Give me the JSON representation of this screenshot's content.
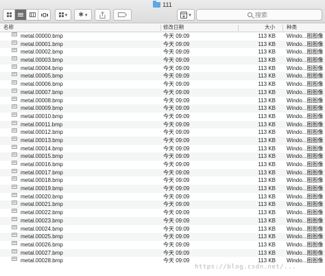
{
  "window": {
    "title": "111"
  },
  "toolbar": {
    "search_placeholder": "搜索"
  },
  "columns": {
    "name": "名称",
    "date": "修改日期",
    "size": "大小",
    "kind": "种类"
  },
  "files": [
    {
      "name": "metal.00000.bmp",
      "date": "今天 09:09",
      "size": "113 KB",
      "kind": "Windo...图图像"
    },
    {
      "name": "metal.00001.bmp",
      "date": "今天 09:09",
      "size": "113 KB",
      "kind": "Windo...图图像"
    },
    {
      "name": "metal.00002.bmp",
      "date": "今天 09:09",
      "size": "113 KB",
      "kind": "Windo...图图像"
    },
    {
      "name": "metal.00003.bmp",
      "date": "今天 09:09",
      "size": "113 KB",
      "kind": "Windo...图图像"
    },
    {
      "name": "metal.00004.bmp",
      "date": "今天 09:09",
      "size": "113 KB",
      "kind": "Windo...图图像"
    },
    {
      "name": "metal.00005.bmp",
      "date": "今天 09:09",
      "size": "113 KB",
      "kind": "Windo...图图像"
    },
    {
      "name": "metal.00006.bmp",
      "date": "今天 09:09",
      "size": "113 KB",
      "kind": "Windo...图图像"
    },
    {
      "name": "metal.00007.bmp",
      "date": "今天 09:09",
      "size": "113 KB",
      "kind": "Windo...图图像"
    },
    {
      "name": "metal.00008.bmp",
      "date": "今天 09:09",
      "size": "113 KB",
      "kind": "Windo...图图像"
    },
    {
      "name": "metal.00009.bmp",
      "date": "今天 09:09",
      "size": "113 KB",
      "kind": "Windo...图图像"
    },
    {
      "name": "metal.00010.bmp",
      "date": "今天 09:09",
      "size": "113 KB",
      "kind": "Windo...图图像"
    },
    {
      "name": "metal.00011.bmp",
      "date": "今天 09:09",
      "size": "113 KB",
      "kind": "Windo...图图像"
    },
    {
      "name": "metal.00012.bmp",
      "date": "今天 09:09",
      "size": "113 KB",
      "kind": "Windo...图图像"
    },
    {
      "name": "metal.00013.bmp",
      "date": "今天 09:09",
      "size": "113 KB",
      "kind": "Windo...图图像"
    },
    {
      "name": "metal.00014.bmp",
      "date": "今天 09:09",
      "size": "113 KB",
      "kind": "Windo...图图像"
    },
    {
      "name": "metal.00015.bmp",
      "date": "今天 09:09",
      "size": "113 KB",
      "kind": "Windo...图图像"
    },
    {
      "name": "metal.00016.bmp",
      "date": "今天 09:09",
      "size": "113 KB",
      "kind": "Windo...图图像"
    },
    {
      "name": "metal.00017.bmp",
      "date": "今天 09:09",
      "size": "113 KB",
      "kind": "Windo...图图像"
    },
    {
      "name": "metal.00018.bmp",
      "date": "今天 09:09",
      "size": "113 KB",
      "kind": "Windo...图图像"
    },
    {
      "name": "metal.00019.bmp",
      "date": "今天 09:09",
      "size": "113 KB",
      "kind": "Windo...图图像"
    },
    {
      "name": "metal.00020.bmp",
      "date": "今天 09:09",
      "size": "113 KB",
      "kind": "Windo...图图像"
    },
    {
      "name": "metal.00021.bmp",
      "date": "今天 09:09",
      "size": "113 KB",
      "kind": "Windo...图图像"
    },
    {
      "name": "metal.00022.bmp",
      "date": "今天 09:09",
      "size": "113 KB",
      "kind": "Windo...图图像"
    },
    {
      "name": "metal.00023.bmp",
      "date": "今天 09:09",
      "size": "113 KB",
      "kind": "Windo...图图像"
    },
    {
      "name": "metal.00024.bmp",
      "date": "今天 09:09",
      "size": "113 KB",
      "kind": "Windo...图图像"
    },
    {
      "name": "metal.00025.bmp",
      "date": "今天 09:09",
      "size": "113 KB",
      "kind": "Windo...图图像"
    },
    {
      "name": "metal.00026.bmp",
      "date": "今天 09:09",
      "size": "113 KB",
      "kind": "Windo...图图像"
    },
    {
      "name": "metal.00027.bmp",
      "date": "今天 09:09",
      "size": "113 KB",
      "kind": "Windo...图图像"
    },
    {
      "name": "metal.00028.bmp",
      "date": "今天 09:09",
      "size": "113 KB",
      "kind": "Windo...图图像"
    }
  ],
  "watermark": "https://blog.csdn.net/..."
}
